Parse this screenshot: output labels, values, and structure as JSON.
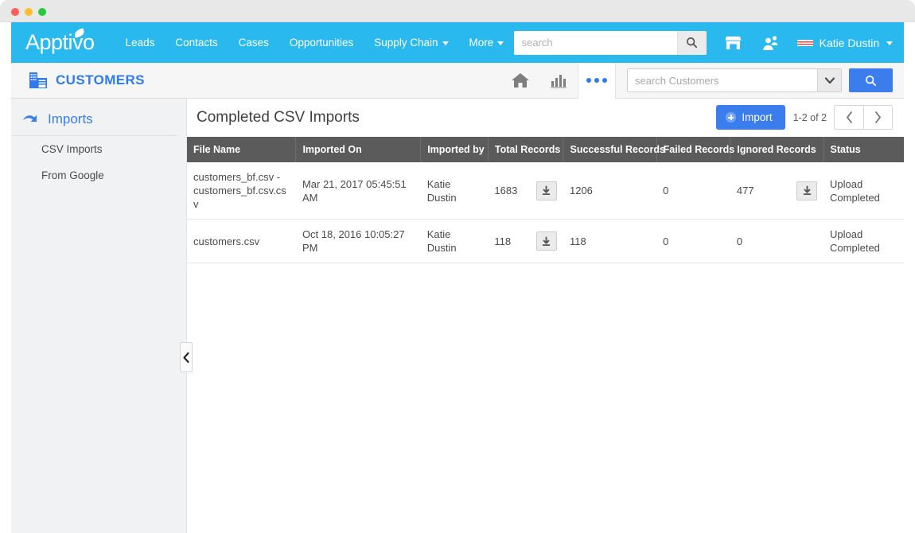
{
  "window": {
    "traffic_lights": [
      "close",
      "minimize",
      "zoom"
    ]
  },
  "topnav": {
    "logo_text": "Apptivo",
    "links": [
      {
        "label": "Leads",
        "has_caret": false
      },
      {
        "label": "Contacts",
        "has_caret": false
      },
      {
        "label": "Cases",
        "has_caret": false
      },
      {
        "label": "Opportunities",
        "has_caret": false
      },
      {
        "label": "Supply Chain",
        "has_caret": true
      },
      {
        "label": "More",
        "has_caret": true
      }
    ],
    "search_placeholder": "search",
    "search_value": "",
    "user_name": "Katie Dustin",
    "accent_color": "#2ab9ee"
  },
  "appheader": {
    "title": "CUSTOMERS",
    "search_placeholder": "search Customers",
    "search_value": "",
    "title_color": "#2f7bec"
  },
  "sidebar": {
    "heading": "Imports",
    "items": [
      {
        "label": "CSV Imports"
      },
      {
        "label": "From Google"
      }
    ]
  },
  "main": {
    "title": "Completed CSV Imports",
    "import_label": "Import",
    "page_count": "1-2 of 2",
    "prev_label": "‹",
    "next_label": "›",
    "table": {
      "columns": [
        "File Name",
        "Imported On",
        "Imported by",
        "Total Records",
        "Successful Records",
        "Failed Records",
        "Ignored Records",
        "Status"
      ],
      "rows": [
        {
          "file_name": "customers_bf.csv - customers_bf.csv.csv",
          "imported_on": "Mar 21, 2017 05:45:51 AM",
          "imported_by": "Katie Dustin",
          "total_records": "1683",
          "total_has_download": true,
          "successful_records": "1206",
          "failed_records": "0",
          "ignored_records": "477",
          "ignored_has_download": true,
          "status": "Upload Completed"
        },
        {
          "file_name": "customers.csv",
          "imported_on": "Oct 18, 2016 10:05:27 PM",
          "imported_by": "Katie Dustin",
          "total_records": "118",
          "total_has_download": true,
          "successful_records": "118",
          "failed_records": "0",
          "ignored_records": "0",
          "ignored_has_download": false,
          "status": "Upload Completed"
        }
      ]
    }
  },
  "icons": {
    "global_search": "search-icon",
    "store": "store-icon",
    "people": "people-icon",
    "home": "home-icon",
    "reports": "bar-chart-icon",
    "more": "more-dots-icon",
    "customers": "building-icon",
    "imports": "import-arrow-icon",
    "download": "download-icon",
    "collapse": "chevron-left-icon"
  }
}
